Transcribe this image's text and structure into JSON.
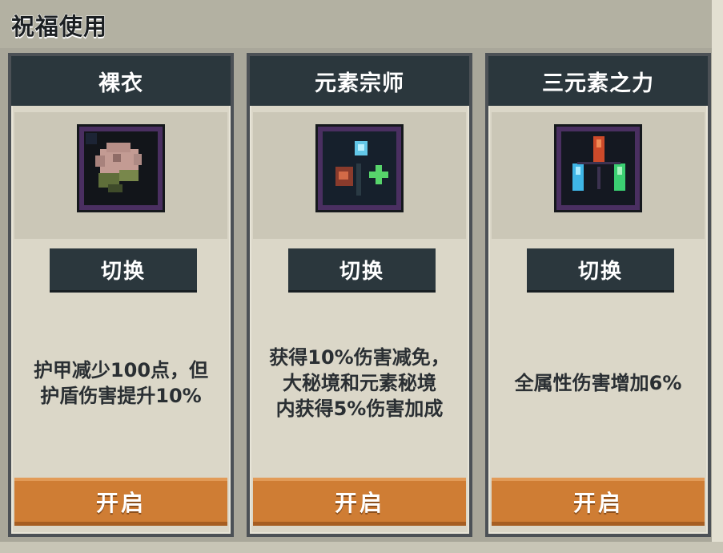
{
  "header": {
    "title": "祝福使用"
  },
  "cards": [
    {
      "name": "裸衣",
      "icon": "pink-flower-icon",
      "switch_label": "切换",
      "description_lines": [
        "护甲减少100点，但",
        "护盾伤害提升10%"
      ],
      "open_label": "开启"
    },
    {
      "name": "元素宗师",
      "icon": "element-gems-icon",
      "switch_label": "切换",
      "description_lines": [
        "获得10%伤害减免，",
        "大秘境和元素秘境",
        "内获得5%伤害加成"
      ],
      "open_label": "开启"
    },
    {
      "name": "三元素之力",
      "icon": "three-crystals-icon",
      "switch_label": "切换",
      "description_lines": [
        "全属性伤害增加6%"
      ],
      "open_label": "开启"
    }
  ],
  "colors": {
    "card_header": "#2b373d",
    "open_button": "#cf7d34",
    "icon_border": "#4a2f61"
  }
}
